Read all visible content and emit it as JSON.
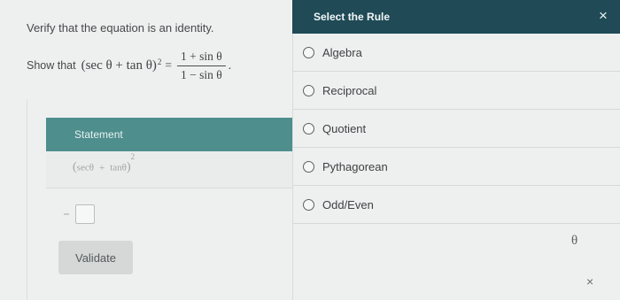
{
  "problem": {
    "instruction": "Verify that the equation is an identity.",
    "show_label": "Show that",
    "lhs_base": "(sec θ + tan θ)",
    "lhs_exp": "2",
    "equals": "=",
    "rhs_num": "1 + sin θ",
    "rhs_den": "1 − sin θ",
    "period": "."
  },
  "work": {
    "statement_header": "Statement",
    "statement_open": "(",
    "statement_t1": "secθ",
    "statement_plus": "+",
    "statement_t2": "tanθ",
    "statement_close": ")",
    "statement_exp": "2",
    "validate_label": "Validate"
  },
  "rules": {
    "title": "Select the Rule",
    "close_symbol": "×",
    "options": [
      "Algebra",
      "Reciprocal",
      "Quotient",
      "Pythagorean",
      "Odd/Even"
    ]
  },
  "toolbar": {
    "theta_symbol": "θ",
    "clear_symbol": "×"
  },
  "colors": {
    "statement_header_bg": "#4e8e8d",
    "rule_header_bg": "#1f4a56"
  }
}
